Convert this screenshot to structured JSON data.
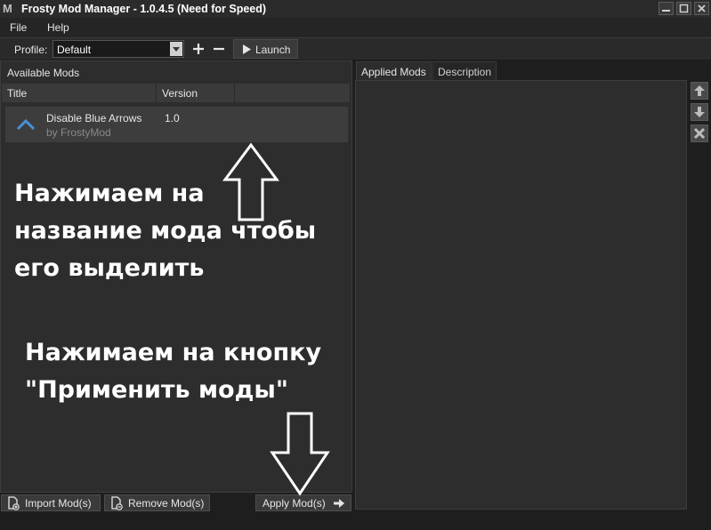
{
  "window": {
    "title": "Frosty Mod Manager - 1.0.4.5 (Need for Speed)",
    "logo_letter": "M"
  },
  "menu": {
    "items": [
      "File",
      "Help"
    ]
  },
  "toolbar": {
    "profile_label": "Profile:",
    "profile_value": "Default",
    "launch_label": "Launch"
  },
  "available_mods": {
    "header": "Available Mods",
    "columns": [
      "Title",
      "Version"
    ],
    "mods": [
      {
        "title": "Disable Blue Arrows",
        "author": "by FrostyMod",
        "version": "1.0"
      }
    ]
  },
  "right_panel": {
    "tabs": [
      "Applied Mods",
      "Description"
    ],
    "active_tab": "Applied Mods"
  },
  "bottom_bar": {
    "import_label": "Import Mod(s)",
    "remove_label": "Remove Mod(s)",
    "apply_label": "Apply Mod(s)"
  },
  "annotations": {
    "select_mod_lines": [
      "Нажимаем на",
      "название мода чтобы",
      "его выделить"
    ],
    "apply_lines": [
      "Нажимаем на кнопку",
      "\"Применить моды\""
    ]
  },
  "icons": [
    "app-logo-icon",
    "minimize-icon",
    "maximize-icon",
    "close-icon",
    "dropdown-icon",
    "plus-icon",
    "minus-icon",
    "play-icon",
    "mod-chevron-icon",
    "move-up-icon",
    "move-down-icon",
    "remove-icon",
    "import-file-icon",
    "remove-file-icon",
    "arrow-right-icon",
    "arrow-up-annotation-icon",
    "arrow-down-annotation-icon"
  ],
  "colors": {
    "background": "#1e1e1e",
    "panel": "#2d2d2d",
    "accent": "#4a90d9",
    "text": "#e6e6e6"
  }
}
